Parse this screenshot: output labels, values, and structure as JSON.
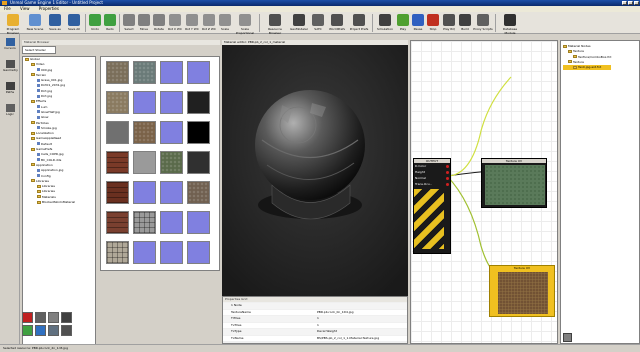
{
  "titlebar": {
    "title": "Unreal Game Engine 1 Editor - Untitled Project"
  },
  "menu": {
    "items": [
      "File",
      "View",
      "Properties"
    ]
  },
  "toolbar": {
    "items": [
      {
        "label": "Program Browser",
        "icon": "folder-open-icon",
        "color": "#e8b030"
      },
      {
        "label": "New Scene",
        "icon": "new-scene-icon",
        "color": "#6090d0"
      },
      {
        "label": "Save as",
        "icon": "save-as-icon",
        "color": "#3060a0"
      },
      {
        "label": "Save All",
        "icon": "save-all-icon",
        "color": "#3060a0"
      },
      {
        "label": "Undo",
        "icon": "undo-icon",
        "color": "#40a040"
      },
      {
        "label": "Redo",
        "icon": "redo-icon",
        "color": "#40a040"
      },
      {
        "label": "Select",
        "icon": "select-icon",
        "color": "#808080"
      },
      {
        "label": "Move",
        "icon": "move-icon",
        "color": "#808080"
      },
      {
        "label": "Rotate",
        "icon": "rotate-icon",
        "color": "#808080"
      },
      {
        "label": "Rot X WC",
        "icon": "rot-x-icon",
        "color": "#909090"
      },
      {
        "label": "Rot Y WC",
        "icon": "rot-y-icon",
        "color": "#909090"
      },
      {
        "label": "Rot Z WC",
        "icon": "rot-z-icon",
        "color": "#909090"
      },
      {
        "label": "Scale",
        "icon": "scale-icon",
        "color": "#909090"
      },
      {
        "label": "Scale Proportional",
        "icon": "scale-proportional-icon",
        "color": "#909090"
      },
      {
        "label": "Resource Browser",
        "icon": "resource-browser-icon",
        "color": "#505050"
      },
      {
        "label": "GeoModeler",
        "icon": "geomodeler-icon",
        "color": "#404040"
      },
      {
        "label": "SATC",
        "icon": "satc-icon",
        "color": "#606060"
      },
      {
        "label": "WorldPrefs",
        "icon": "world-prefs-icon",
        "color": "#505050"
      },
      {
        "label": "Project Prefs",
        "icon": "project-prefs-icon",
        "color": "#505050"
      },
      {
        "label": "Simulation",
        "icon": "simulation-icon",
        "color": "#404040"
      },
      {
        "label": "Play",
        "icon": "play-icon",
        "color": "#50a030"
      },
      {
        "label": "Pause",
        "icon": "pause-icon",
        "color": "#3060c0"
      },
      {
        "label": "Stop",
        "icon": "stop-icon",
        "color": "#c03020"
      },
      {
        "label": "Play RQ",
        "icon": "play-rq-icon",
        "color": "#505050"
      },
      {
        "label": "Build",
        "icon": "build-icon",
        "color": "#404040"
      },
      {
        "label": "Proxy Scripts",
        "icon": "proxy-scripts-icon",
        "color": "#606060"
      },
      {
        "label": "Database Module",
        "icon": "database-module-icon",
        "color": "#303030"
      }
    ]
  },
  "leftstrip": {
    "items": [
      "Cursors",
      "Geometry",
      "Paths",
      "Logic"
    ]
  },
  "browser": {
    "header": "Material Browser",
    "tab": "Select Shader",
    "tree": [
      {
        "label": "Global",
        "indent": 0,
        "type": "folder"
      },
      {
        "label": "Video",
        "indent": 1,
        "type": "folder"
      },
      {
        "label": "000.jpg",
        "indent": 2,
        "type": "file"
      },
      {
        "label": "Terrain",
        "indent": 1,
        "type": "folder"
      },
      {
        "label": "Grass_001.jpg",
        "indent": 2,
        "type": "file"
      },
      {
        "label": "Dirt01_2031.jpg",
        "indent": 2,
        "type": "file"
      },
      {
        "label": "Dirt.jpg",
        "indent": 2,
        "type": "file"
      },
      {
        "label": "Dirt.jpg",
        "indent": 2,
        "type": "file"
      },
      {
        "label": "Effects",
        "indent": 1,
        "type": "folder"
      },
      {
        "label": "Lum",
        "indent": 2,
        "type": "file"
      },
      {
        "label": "GlowHalf.jpg",
        "indent": 2,
        "type": "file"
      },
      {
        "label": "Glow",
        "indent": 2,
        "type": "file"
      },
      {
        "label": "Particles",
        "indent": 1,
        "type": "folder"
      },
      {
        "label": "Smoke.jpg",
        "indent": 2,
        "type": "file"
      },
      {
        "label": "Localization",
        "indent": 1,
        "type": "folder"
      },
      {
        "label": "GameAppleNeed",
        "indent": 1,
        "type": "folder"
      },
      {
        "label": "Default",
        "indent": 2,
        "type": "file"
      },
      {
        "label": "GamePrefs",
        "indent": 1,
        "type": "folder"
      },
      {
        "label": "Cells_COPR.jpg",
        "indent": 2,
        "type": "file"
      },
      {
        "label": "BC_COLD.dds",
        "indent": 2,
        "type": "file"
      },
      {
        "label": "Application",
        "indent": 1,
        "type": "folder"
      },
      {
        "label": "Application.jpg",
        "indent": 2,
        "type": "file"
      },
      {
        "label": "Config",
        "indent": 2,
        "type": "file"
      },
      {
        "label": "Libraries",
        "indent": 1,
        "type": "folder"
      },
      {
        "label": "Libraries",
        "indent": 2,
        "type": "folder"
      },
      {
        "label": "Libraries",
        "indent": 2,
        "type": "folder"
      },
      {
        "label": "Materials",
        "indent": 2,
        "type": "folder"
      },
      {
        "label": "BlockedSkinInMaterial",
        "indent": 2,
        "type": "folder"
      }
    ],
    "thumbnails": [
      {
        "kind": "stone",
        "color": "#7a6e5a"
      },
      {
        "kind": "grate",
        "color": "#6a7a78"
      },
      {
        "kind": "blank",
        "color": "#8080e0"
      },
      {
        "kind": "blank",
        "color": "#8080e0"
      },
      {
        "kind": "stone",
        "color": "#8a7a60"
      },
      {
        "kind": "blank",
        "color": "#8080e0"
      },
      {
        "kind": "blank",
        "color": "#8080e0"
      },
      {
        "kind": "dark",
        "color": "#202020"
      },
      {
        "kind": "grey",
        "color": "#707070"
      },
      {
        "kind": "rust",
        "color": "#7a6248"
      },
      {
        "kind": "blank",
        "color": "#8080e0"
      },
      {
        "kind": "black",
        "color": "#000000"
      },
      {
        "kind": "brick",
        "color": "#7a3a28"
      },
      {
        "kind": "grey",
        "color": "#9a9a9a"
      },
      {
        "kind": "green",
        "color": "#5a6a4a"
      },
      {
        "kind": "dark",
        "color": "#303030"
      },
      {
        "kind": "brick",
        "color": "#6a3020"
      },
      {
        "kind": "blank",
        "color": "#8080e0"
      },
      {
        "kind": "blank",
        "color": "#8080e0"
      },
      {
        "kind": "stone",
        "color": "#706050"
      },
      {
        "kind": "brick",
        "color": "#7a4030"
      },
      {
        "kind": "tile",
        "color": "#9a9a9a"
      },
      {
        "kind": "blank",
        "color": "#8080e0"
      },
      {
        "kind": "blank",
        "color": "#8080e0"
      },
      {
        "kind": "tile",
        "color": "#b0a898"
      },
      {
        "kind": "blank",
        "color": "#8080e0"
      },
      {
        "kind": "blank",
        "color": "#8080e0"
      },
      {
        "kind": "blank",
        "color": "#8080e0"
      }
    ]
  },
  "viewbuttons": [
    {
      "icon": "red-sphere-icon",
      "color": "#c02020"
    },
    {
      "icon": "cube-icon",
      "color": "#606060"
    },
    {
      "icon": "refresh-icon",
      "color": "#808080"
    },
    {
      "icon": "close-icon",
      "color": "#404040"
    },
    {
      "icon": "grid-icon",
      "color": "#40a040"
    },
    {
      "icon": "plus-icon",
      "color": "#3070c0"
    },
    {
      "icon": "sphere-icon",
      "color": "#607080"
    },
    {
      "icon": "camera-icon",
      "color": "#505050"
    }
  ],
  "viewport": {
    "header": "Material editor: PBR.pb_2_col_1_material"
  },
  "properties": {
    "header": "Properties Grid",
    "rows": [
      {
        "key": "1 Node",
        "value": ""
      },
      {
        "key": "TextureName",
        "value": "PBR.pb.rock_0n_1D4.jpg"
      },
      {
        "key": "TiTiles",
        "value": "1"
      },
      {
        "key": "TvTiles",
        "value": "1"
      },
      {
        "key": "TxType",
        "value": "Decal Weight"
      },
      {
        "key": "TxName",
        "value": "BS/PBS.pb_2_col_1_1.Material.Texture.jpg"
      }
    ]
  },
  "graph": {
    "output_title": "OUTPUT",
    "output_rows": [
      "D.Color",
      "Height",
      "Normal",
      "Trans.Ocu.."
    ],
    "texture1_title": "Texture UV",
    "texture2_title": "Texture UV"
  },
  "scene": {
    "tree": [
      {
        "label": "Material Nodes",
        "indent": 0
      },
      {
        "label": "Texture",
        "indent": 1
      },
      {
        "label": "TexTure/ComboBox.fnt",
        "indent": 2
      },
      {
        "label": "Texture",
        "indent": 1
      },
      {
        "label": "Tex0.jpg.ext.fnt",
        "indent": 2
      }
    ]
  },
  "status": {
    "text": "Selected resource: PBR.pb.rock_2n_1d3.jpg"
  }
}
